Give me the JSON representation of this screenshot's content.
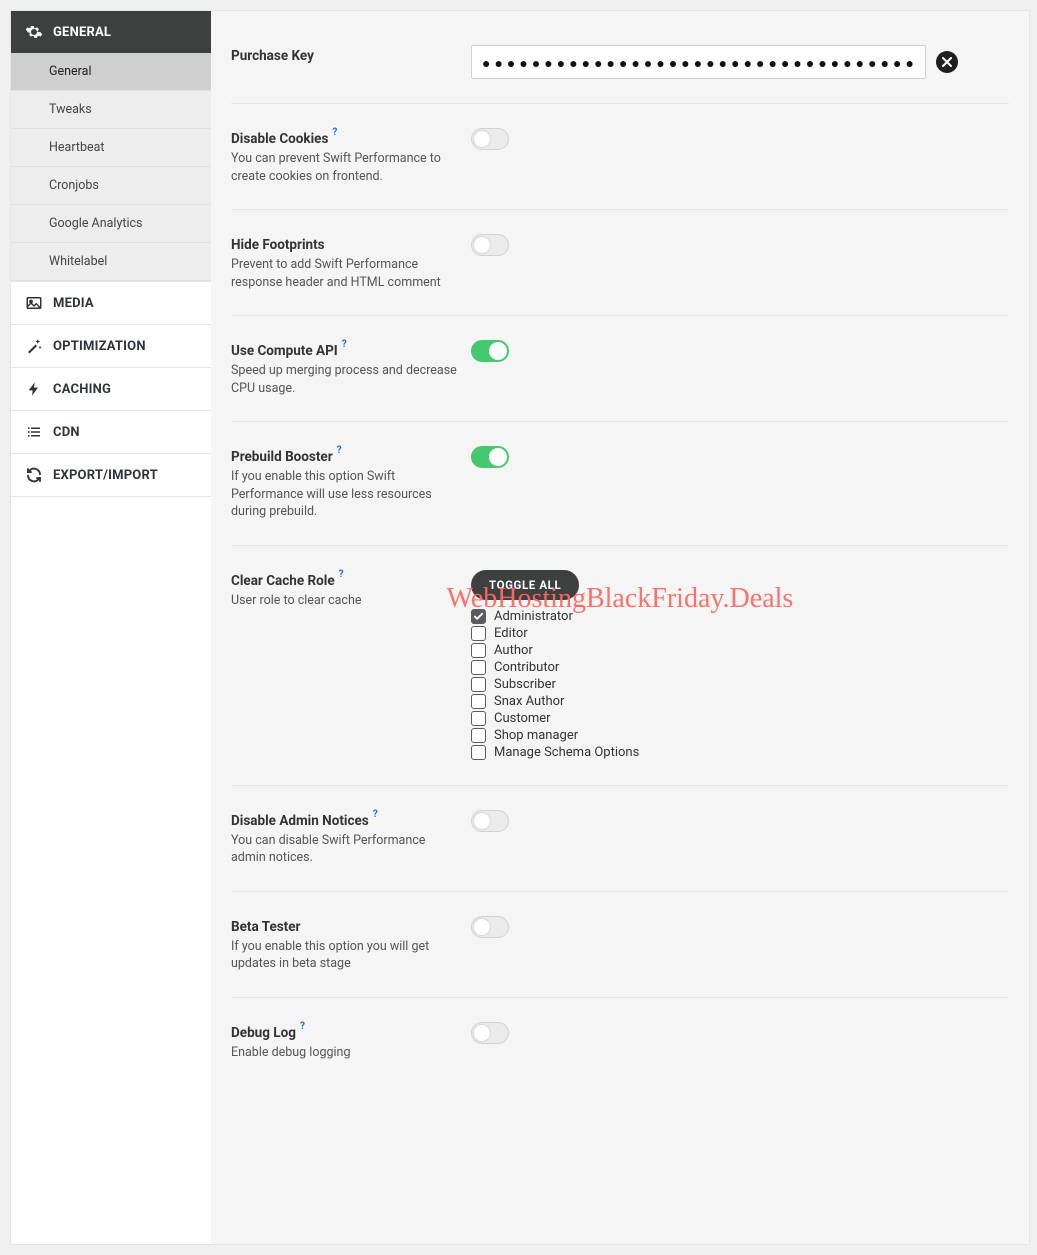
{
  "sidebar": {
    "sections": [
      {
        "id": "general",
        "label": "GENERAL",
        "active": true,
        "icon": "gear",
        "subitems": [
          {
            "id": "general-sub",
            "label": "General",
            "active": true
          },
          {
            "id": "tweaks",
            "label": "Tweaks",
            "active": false
          },
          {
            "id": "heartbeat",
            "label": "Heartbeat",
            "active": false
          },
          {
            "id": "cronjobs",
            "label": "Cronjobs",
            "active": false
          },
          {
            "id": "google-analytics",
            "label": "Google Analytics",
            "active": false
          },
          {
            "id": "whitelabel",
            "label": "Whitelabel",
            "active": false
          }
        ]
      },
      {
        "id": "media",
        "label": "MEDIA",
        "icon": "image"
      },
      {
        "id": "optimization",
        "label": "OPTIMIZATION",
        "icon": "wand"
      },
      {
        "id": "caching",
        "label": "CACHING",
        "icon": "bolt"
      },
      {
        "id": "cdn",
        "label": "CDN",
        "icon": "list"
      },
      {
        "id": "export-import",
        "label": "EXPORT/IMPORT",
        "icon": "refresh"
      }
    ]
  },
  "settings": {
    "purchase_key": {
      "label": "Purchase Key",
      "mask": "●●●●●●●●●●●●●●●●●●●●●●●●●●●●●●●●●●●"
    },
    "disable_cookies": {
      "label": "Disable Cookies",
      "help": true,
      "desc": "You can prevent Swift Performance to create cookies on frontend.",
      "value": false
    },
    "hide_footprints": {
      "label": "Hide Footprints",
      "help": false,
      "desc": "Prevent to add Swift Performance response header and HTML comment",
      "value": false
    },
    "use_compute_api": {
      "label": "Use Compute API",
      "help": true,
      "desc": "Speed up merging process and decrease CPU usage.",
      "value": true
    },
    "prebuild_booster": {
      "label": "Prebuild Booster",
      "help": true,
      "desc": "If you enable this option Swift Performance will use less resources during prebuild.",
      "value": true
    },
    "clear_cache_role": {
      "label": "Clear Cache Role",
      "help": true,
      "desc": "User role to clear cache",
      "toggle_all_label": "TOGGLE ALL",
      "roles": [
        {
          "label": "Administrator",
          "checked": true
        },
        {
          "label": "Editor",
          "checked": false
        },
        {
          "label": "Author",
          "checked": false
        },
        {
          "label": "Contributor",
          "checked": false
        },
        {
          "label": "Subscriber",
          "checked": false
        },
        {
          "label": "Snax Author",
          "checked": false
        },
        {
          "label": "Customer",
          "checked": false
        },
        {
          "label": "Shop manager",
          "checked": false
        },
        {
          "label": "Manage Schema Options",
          "checked": false
        }
      ]
    },
    "disable_admin_notices": {
      "label": "Disable Admin Notices",
      "help": true,
      "desc": "You can disable Swift Performance admin notices.",
      "value": false
    },
    "beta_tester": {
      "label": "Beta Tester",
      "help": false,
      "desc": "If you enable this option you will get updates in beta stage",
      "value": false
    },
    "debug_log": {
      "label": "Debug Log",
      "help": true,
      "desc": "Enable debug logging",
      "value": false
    }
  },
  "watermark": "WebHostingBlackFriday.Deals",
  "help_glyph": "?"
}
